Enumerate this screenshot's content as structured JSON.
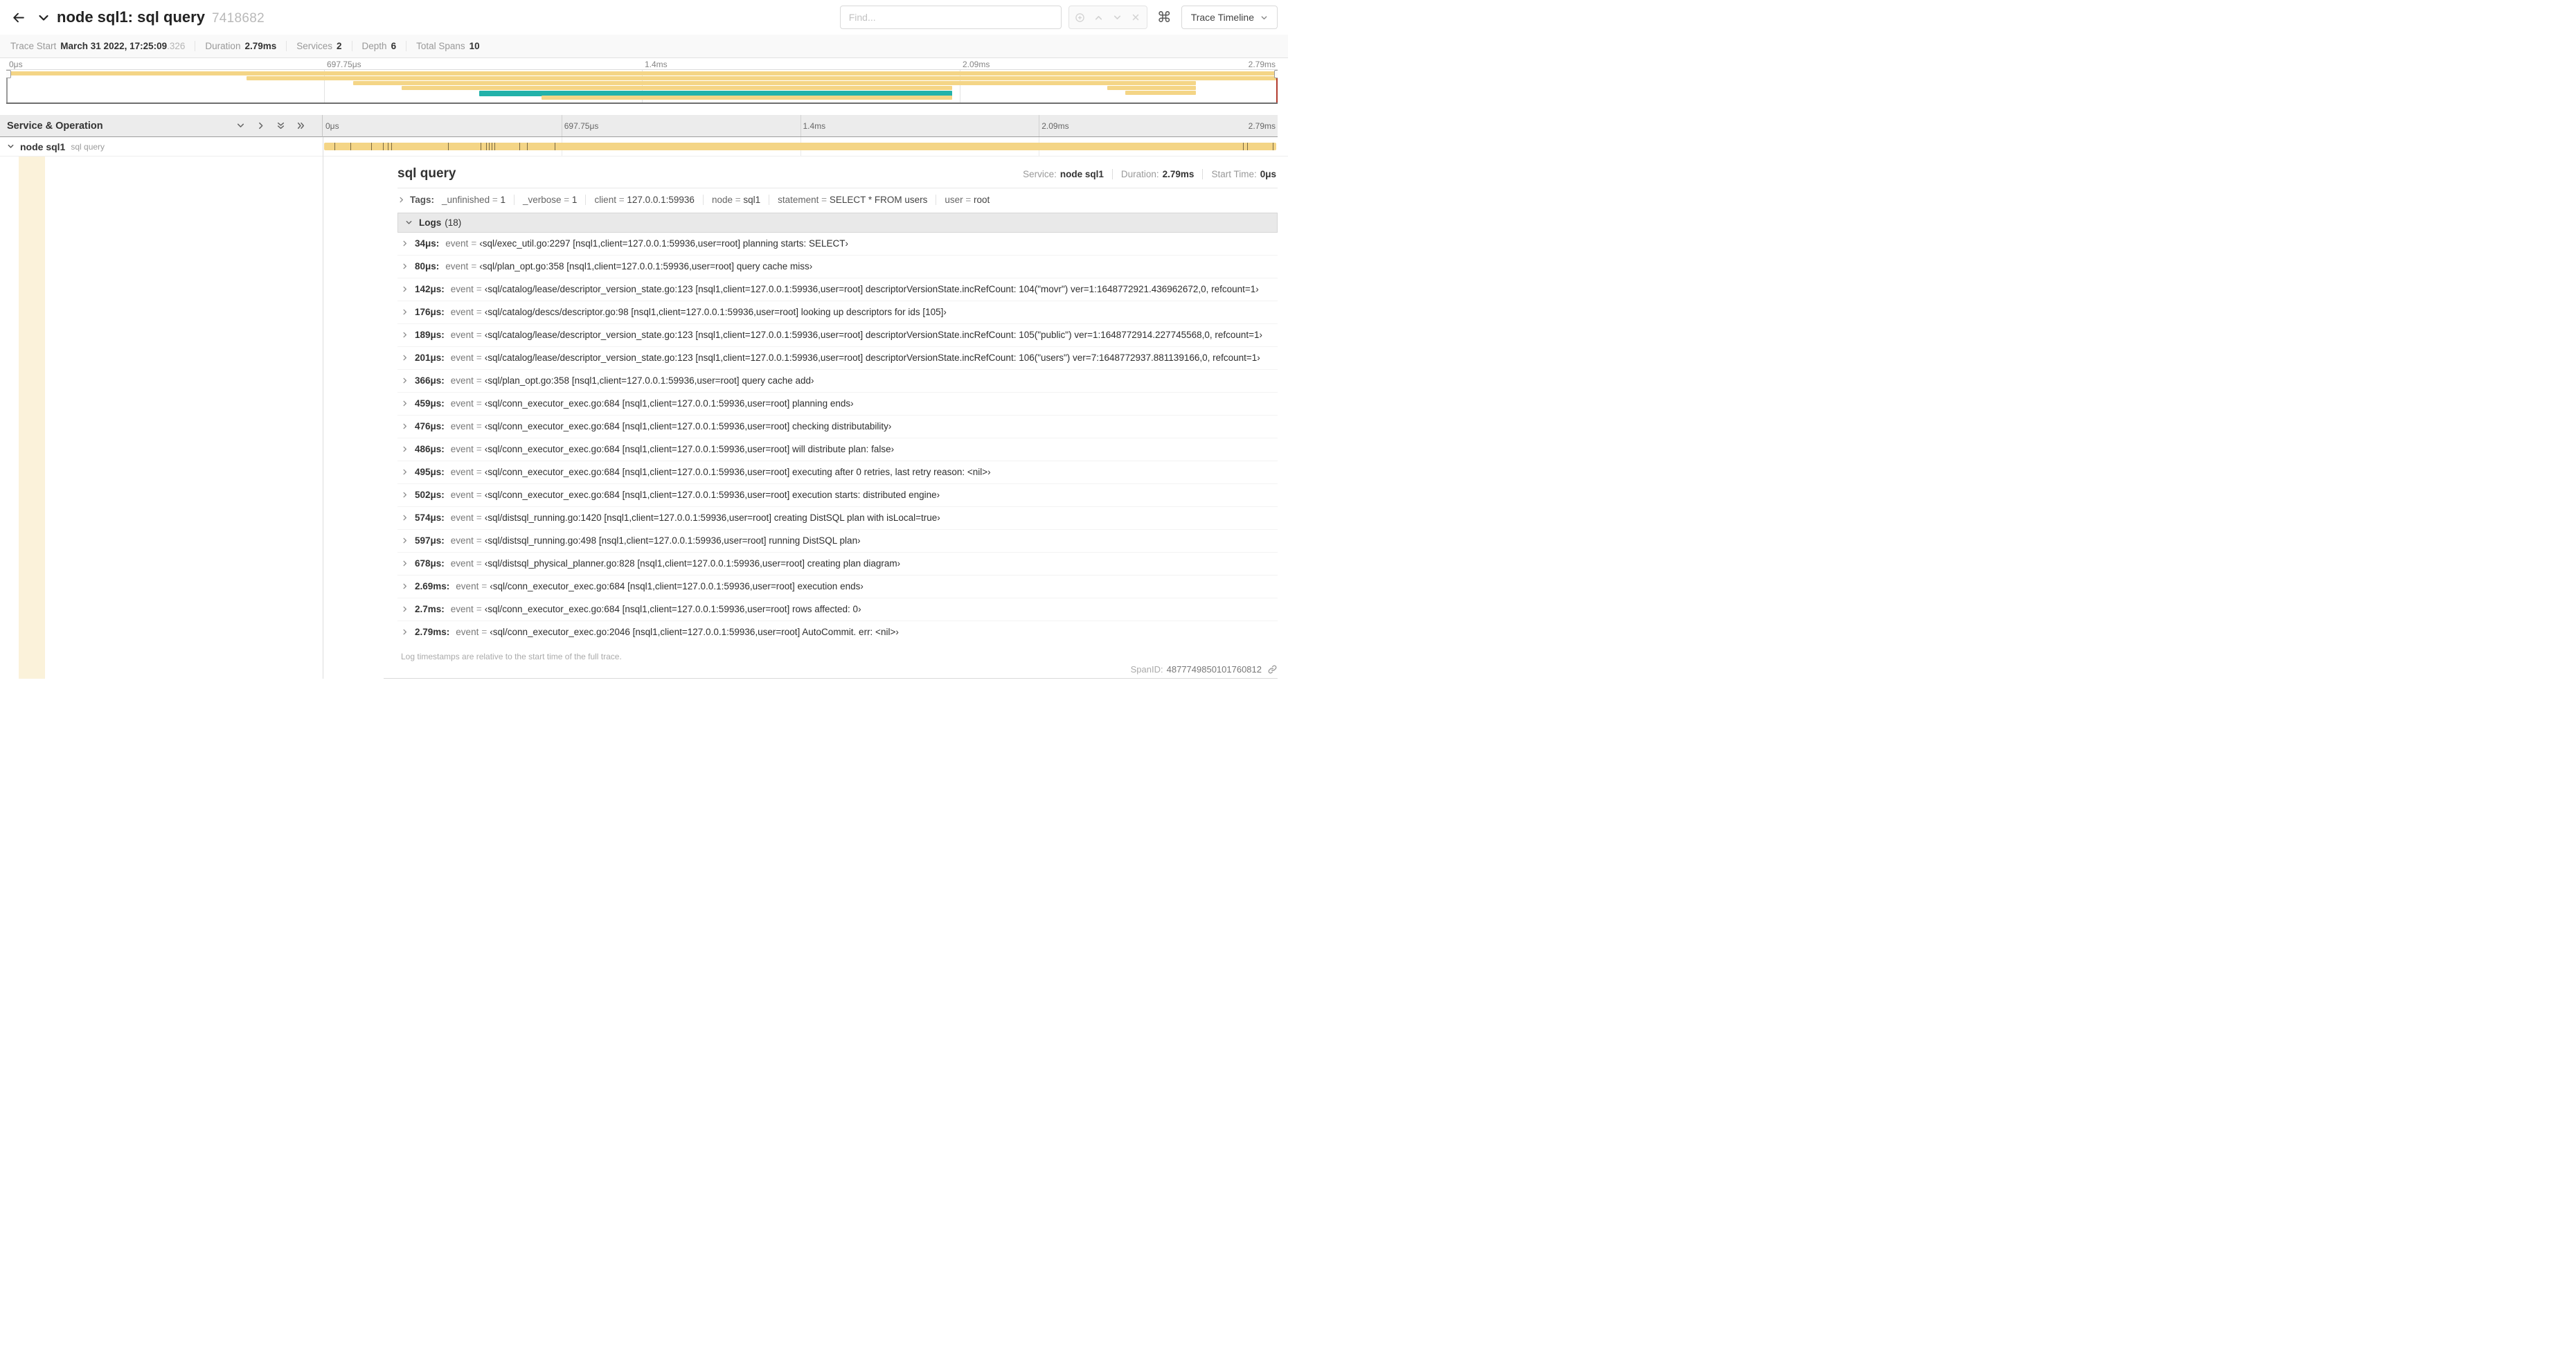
{
  "header": {
    "title": "node sql1: sql query",
    "trace_id": "7418682",
    "find_placeholder": "Find...",
    "trace_timeline_label": "Trace Timeline"
  },
  "icons": {
    "command": "⌘"
  },
  "summary": {
    "items": [
      {
        "label": "Trace Start",
        "value": "March 31 2022, 17:25:09",
        "suffix": ".326"
      },
      {
        "label": "Duration",
        "value": "2.79ms",
        "suffix": ""
      },
      {
        "label": "Services",
        "value": "2",
        "suffix": ""
      },
      {
        "label": "Depth",
        "value": "6",
        "suffix": ""
      },
      {
        "label": "Total Spans",
        "value": "10",
        "suffix": ""
      }
    ]
  },
  "time_ticks": [
    "0μs",
    "697.75μs",
    "1.4ms",
    "2.09ms",
    "2.79ms"
  ],
  "minimap": {
    "bars": [
      {
        "row": 0,
        "left": 0,
        "width": 100,
        "color": "tan"
      },
      {
        "row": 1,
        "left": 18.9,
        "width": 81.1,
        "color": "tan"
      },
      {
        "row": 2,
        "left": 27.3,
        "width": 66.3,
        "color": "tan"
      },
      {
        "row": 3,
        "left": 31.1,
        "width": 43.3,
        "color": "tan"
      },
      {
        "row": 4,
        "left": 37.2,
        "width": 37.2,
        "color": "teal"
      },
      {
        "row": 5,
        "left": 42.1,
        "width": 32.3,
        "color": "tan"
      },
      {
        "row": 3,
        "left": 86.6,
        "width": 7.0,
        "color": "tan"
      },
      {
        "row": 4,
        "left": 88.0,
        "width": 5.6,
        "color": "tan"
      }
    ]
  },
  "timeline": {
    "left_header": "Service & Operation",
    "span_row": {
      "service": "node sql1",
      "operation": "sql query",
      "bar_left": 0.15,
      "bar_width": 99.7,
      "log_markers": [
        1.2,
        2.9,
        5.1,
        6.3,
        6.8,
        7.2,
        13.1,
        16.5,
        17.1,
        17.4,
        17.7,
        18.0,
        20.6,
        21.4,
        24.3,
        96.4,
        96.8,
        99.5
      ]
    }
  },
  "detail": {
    "title": "sql query",
    "meta": [
      {
        "label": "Service:",
        "value": "node sql1"
      },
      {
        "label": "Duration:",
        "value": "2.79ms"
      },
      {
        "label": "Start Time:",
        "value": "0μs"
      }
    ],
    "tags_label": "Tags:",
    "tags": [
      {
        "key": "_unfinished",
        "value": "1"
      },
      {
        "key": "_verbose",
        "value": "1"
      },
      {
        "key": "client",
        "value": "127.0.0.1:59936"
      },
      {
        "key": "node",
        "value": "sql1"
      },
      {
        "key": "statement",
        "value": "SELECT * FROM users"
      },
      {
        "key": "user",
        "value": "root"
      }
    ],
    "logs_label": "Logs",
    "logs_count": "(18)",
    "logs": [
      {
        "time": "34μs:",
        "key": "event",
        "value": "‹sql/exec_util.go:2297 [nsql1,client=127.0.0.1:59936,user=root] planning starts: SELECT›"
      },
      {
        "time": "80μs:",
        "key": "event",
        "value": "‹sql/plan_opt.go:358 [nsql1,client=127.0.0.1:59936,user=root] query cache miss›"
      },
      {
        "time": "142μs:",
        "key": "event",
        "value": "‹sql/catalog/lease/descriptor_version_state.go:123 [nsql1,client=127.0.0.1:59936,user=root] descriptorVersionState.incRefCount: 104(\"movr\") ver=1:1648772921.436962672,0, refcount=1›"
      },
      {
        "time": "176μs:",
        "key": "event",
        "value": "‹sql/catalog/descs/descriptor.go:98 [nsql1,client=127.0.0.1:59936,user=root] looking up descriptors for ids [105]›"
      },
      {
        "time": "189μs:",
        "key": "event",
        "value": "‹sql/catalog/lease/descriptor_version_state.go:123 [nsql1,client=127.0.0.1:59936,user=root] descriptorVersionState.incRefCount: 105(\"public\") ver=1:1648772914.227745568,0, refcount=1›"
      },
      {
        "time": "201μs:",
        "key": "event",
        "value": "‹sql/catalog/lease/descriptor_version_state.go:123 [nsql1,client=127.0.0.1:59936,user=root] descriptorVersionState.incRefCount: 106(\"users\") ver=7:1648772937.881139166,0, refcount=1›"
      },
      {
        "time": "366μs:",
        "key": "event",
        "value": "‹sql/plan_opt.go:358 [nsql1,client=127.0.0.1:59936,user=root] query cache add›"
      },
      {
        "time": "459μs:",
        "key": "event",
        "value": "‹sql/conn_executor_exec.go:684 [nsql1,client=127.0.0.1:59936,user=root] planning ends›"
      },
      {
        "time": "476μs:",
        "key": "event",
        "value": "‹sql/conn_executor_exec.go:684 [nsql1,client=127.0.0.1:59936,user=root] checking distributability›"
      },
      {
        "time": "486μs:",
        "key": "event",
        "value": "‹sql/conn_executor_exec.go:684 [nsql1,client=127.0.0.1:59936,user=root] will distribute plan: false›"
      },
      {
        "time": "495μs:",
        "key": "event",
        "value": "‹sql/conn_executor_exec.go:684 [nsql1,client=127.0.0.1:59936,user=root] executing after 0 retries, last retry reason: <nil>›"
      },
      {
        "time": "502μs:",
        "key": "event",
        "value": "‹sql/conn_executor_exec.go:684 [nsql1,client=127.0.0.1:59936,user=root] execution starts: distributed engine›"
      },
      {
        "time": "574μs:",
        "key": "event",
        "value": "‹sql/distsql_running.go:1420 [nsql1,client=127.0.0.1:59936,user=root] creating DistSQL plan with isLocal=true›"
      },
      {
        "time": "597μs:",
        "key": "event",
        "value": "‹sql/distsql_running.go:498 [nsql1,client=127.0.0.1:59936,user=root] running DistSQL plan›"
      },
      {
        "time": "678μs:",
        "key": "event",
        "value": "‹sql/distsql_physical_planner.go:828 [nsql1,client=127.0.0.1:59936,user=root] creating plan diagram›"
      },
      {
        "time": "2.69ms:",
        "key": "event",
        "value": "‹sql/conn_executor_exec.go:684 [nsql1,client=127.0.0.1:59936,user=root] execution ends›"
      },
      {
        "time": "2.7ms:",
        "key": "event",
        "value": "‹sql/conn_executor_exec.go:684 [nsql1,client=127.0.0.1:59936,user=root] rows affected: 0›"
      },
      {
        "time": "2.79ms:",
        "key": "event",
        "value": "‹sql/conn_executor_exec.go:2046 [nsql1,client=127.0.0.1:59936,user=root] AutoCommit. err: <nil>›"
      }
    ],
    "footer_note": "Log timestamps are relative to the start time of the full trace.",
    "span_id_label": "SpanID:",
    "span_id": "4877749850101760812"
  },
  "colors": {
    "tan": "#F4D586",
    "teal": "#22B2AA",
    "cream": "#FBF2DA"
  }
}
